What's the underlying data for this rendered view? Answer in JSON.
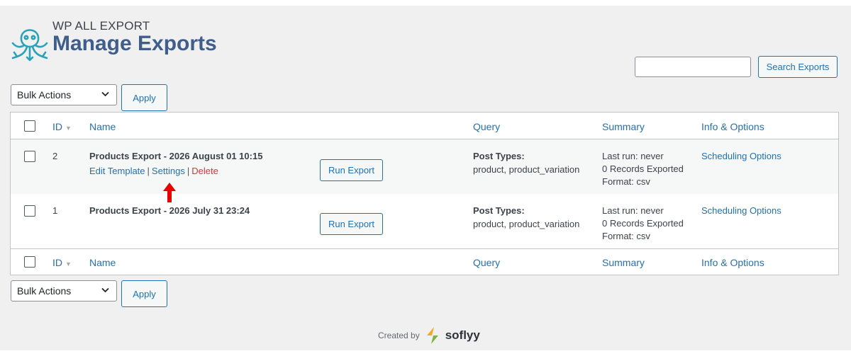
{
  "brand": {
    "subtitle": "WP ALL EXPORT",
    "title": "Manage Exports"
  },
  "search": {
    "value": "",
    "placeholder": "",
    "button_label": "Search Exports"
  },
  "bulk": {
    "selected": "Bulk Actions",
    "apply_label": "Apply"
  },
  "table": {
    "columns": {
      "id": "ID",
      "name": "Name",
      "query": "Query",
      "summary": "Summary",
      "info": "Info & Options"
    },
    "rows": [
      {
        "id": "2",
        "name": "Products Export - 2026 August 01 10:15",
        "actions": {
          "edit": "Edit Template",
          "settings": "Settings",
          "delete": "Delete",
          "separator": "|"
        },
        "run_label": "Run Export",
        "query_label": "Post Types:",
        "query_value": "product, product_variation",
        "summary": [
          "Last run: never",
          "0 Records Exported",
          "Format: csv"
        ],
        "info_link": "Scheduling Options"
      },
      {
        "id": "1",
        "name": "Products Export - 2026 July 31 23:24",
        "run_label": "Run Export",
        "query_label": "Post Types:",
        "query_value": "product, product_variation",
        "summary": [
          "Last run: never",
          "0 Records Exported",
          "Format: csv"
        ],
        "info_link": "Scheduling Options"
      }
    ]
  },
  "footer": {
    "created_by": "Created by",
    "company": "soflyy"
  },
  "colors": {
    "accent": "#2271b1",
    "brand_title": "#3f5e8c",
    "logo": "#2aa3b8",
    "danger": "#d63638",
    "arrow": "#e60000"
  },
  "icons": {
    "logo": "octopus-logo-icon",
    "chevron": "chevron-down-icon",
    "arrow": "red-arrow-icon",
    "sort": "sort-caret-icon",
    "company": "soflyy-logo-icon"
  }
}
